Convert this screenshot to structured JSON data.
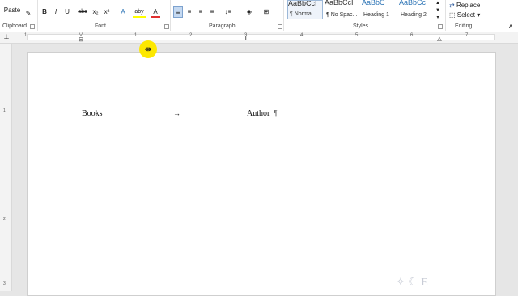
{
  "ribbon": {
    "clipboard": {
      "paste_label": "Paste",
      "group_label": "Clipboard"
    },
    "font": {
      "group_label": "Font",
      "buttons": [
        "B",
        "I",
        "U",
        "abc",
        "x₂",
        "x²",
        "A",
        "aby",
        "A"
      ]
    },
    "paragraph": {
      "group_label": "Paragraph"
    },
    "styles": {
      "group_label": "Styles",
      "items": [
        {
          "sample": "AaBbCcI",
          "name": "¶ Normal",
          "selected": true
        },
        {
          "sample": "AaBbCcI",
          "name": "¶ No Spac..."
        },
        {
          "sample": "AaBbC",
          "name": "Heading 1"
        },
        {
          "sample": "AaBbCc",
          "name": "Heading 2"
        }
      ]
    },
    "editing": {
      "group_label": "Editing",
      "replace_label": "Replace",
      "select_label": "Select ▾"
    }
  },
  "ruler": {
    "numbers": [
      "1",
      "1",
      "2",
      "3",
      "4",
      "5",
      "6",
      "7"
    ]
  },
  "vruler": {
    "numbers": [
      "1",
      "2",
      "3"
    ]
  },
  "document": {
    "word1": "Books",
    "tab_mark": "→",
    "word2": "Author",
    "cursor_mark": "¶"
  }
}
